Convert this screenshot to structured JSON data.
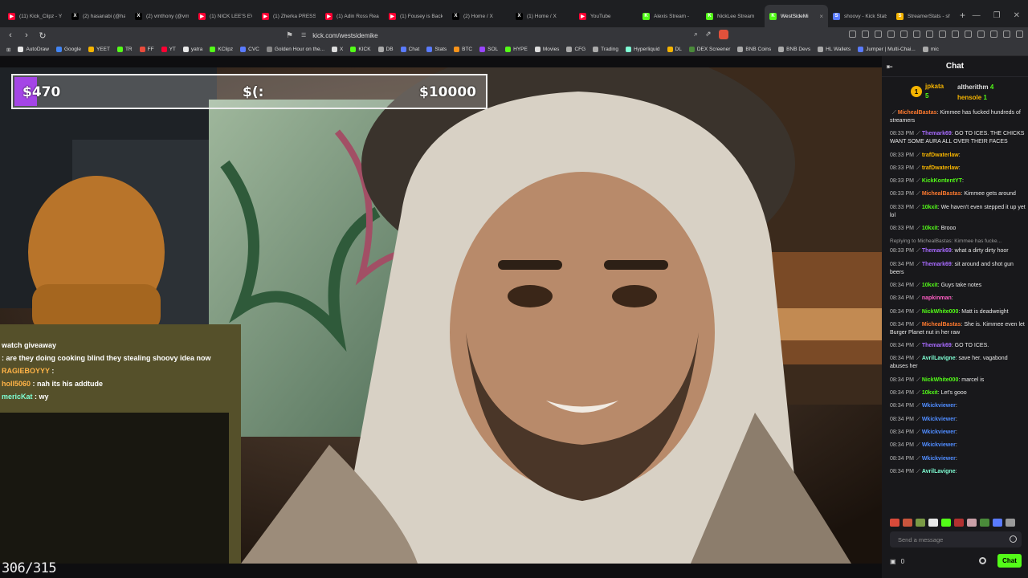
{
  "browser": {
    "tabs": [
      {
        "label": "(11) Kick_Clipz - You",
        "color": "#ff0033",
        "glyph": "▶"
      },
      {
        "label": "(2) hasanabi (@has",
        "color": "#000000",
        "glyph": "X"
      },
      {
        "label": "(2) vmthony (@vmth",
        "color": "#000000",
        "glyph": "X"
      },
      {
        "label": "(1) NICK LEE'S EVEN",
        "color": "#ff0033",
        "glyph": "▶"
      },
      {
        "label": "(1) Zherka PRESSE",
        "color": "#ff0033",
        "glyph": "▶"
      },
      {
        "label": "(1) Adin Ross Reacts",
        "color": "#ff0033",
        "glyph": "▶"
      },
      {
        "label": "(1) Fousey is Back |",
        "color": "#ff0033",
        "glyph": "▶"
      },
      {
        "label": "(2) Home / X",
        "color": "#000000",
        "glyph": "X"
      },
      {
        "label": "(1) Home / X",
        "color": "#000000",
        "glyph": "X"
      },
      {
        "label": "YouTube",
        "color": "#ff0033",
        "glyph": "▶"
      },
      {
        "label": "Alexis Stream -",
        "color": "#53fc18",
        "glyph": "K"
      },
      {
        "label": "NickLee Stream",
        "color": "#53fc18",
        "glyph": "K"
      },
      {
        "label": "WestSideMi",
        "color": "#53fc18",
        "glyph": "K",
        "active": true
      },
      {
        "label": "shoovy - Kick Stats",
        "color": "#5a7bff",
        "glyph": "S"
      },
      {
        "label": "StreamerStats - sho",
        "color": "#f5b400",
        "glyph": "S"
      }
    ],
    "url": "kick.com/westsidemike",
    "bookmarks": [
      "AutoDraw",
      "Google",
      "YEET",
      "TR",
      "FF",
      "YT",
      "yatra",
      "KClipz",
      "CVC",
      "Golden Hour on the...",
      "X",
      "KICK",
      "DB",
      "Chat",
      "Stats",
      "BTC",
      "SOL",
      "HYPE",
      "Movies",
      "CFG",
      "Trading",
      "Hyperliquid",
      "DL",
      "DEX Screener",
      "BNB Coins",
      "BNB Devs",
      "HL Wallets",
      "Jumper | Multi-Chai...",
      "mic"
    ]
  },
  "stream": {
    "overlay": {
      "current": "$470",
      "middle": "$(:",
      "goal": "$10000",
      "progress": 0.047,
      "fill_color": "#a445e6"
    },
    "video_chat": [
      {
        "user": "",
        "text": "watch giveaway",
        "color": "#ffffff"
      },
      {
        "user": "",
        "text": ": are they doing cooking blind they stealing shoovy idea now",
        "color": "#ff6f61"
      },
      {
        "user": "RAGIEBOYYY",
        "text": " : ",
        "color": "#ffb347"
      },
      {
        "user": "holl5060",
        "text": " : nah its his addtude",
        "color": "#ffb347"
      },
      {
        "user": "mericKat",
        "text": " : wy",
        "color": "#7fffd4"
      }
    ],
    "counter": "306/315"
  },
  "chat": {
    "title": "Chat",
    "leaderboard": [
      {
        "name": "jpkata",
        "count": "5"
      },
      {
        "name": "altherithm",
        "count": "4"
      },
      {
        "name": "hensole",
        "count": "1"
      }
    ],
    "messages": [
      {
        "time": "",
        "user": "MichealBastas",
        "color": "#ff7a2f",
        "text": ": Kimmee has fucked hundreds of streamers"
      },
      {
        "time": "08:33 PM",
        "user": "Themark69",
        "color": "#a86bff",
        "text": ": GO TO ICES. THE CHICKS WANT SOME AURA ALL OVER THEIR FACES"
      },
      {
        "time": "08:33 PM",
        "user": "trafDwaterlaw",
        "color": "#f5b400",
        "text": ":"
      },
      {
        "time": "08:33 PM",
        "user": "trafDwaterlaw",
        "color": "#f5b400",
        "text": ":"
      },
      {
        "time": "08:33 PM",
        "user": "KickKontentYT",
        "color": "#53fc18",
        "text": ":"
      },
      {
        "time": "08:33 PM",
        "user": "MichealBastas",
        "color": "#ff7a2f",
        "text": ": Kimmee gets around"
      },
      {
        "time": "08:33 PM",
        "user": "10kxit",
        "color": "#53fc18",
        "text": ": We haven't even stepped it up yet lol"
      },
      {
        "time": "08:33 PM",
        "user": "10kxit",
        "color": "#53fc18",
        "text": ": Brooo"
      },
      {
        "time": "08:33 PM",
        "user": "Themark69",
        "color": "#a86bff",
        "text": ": what a dirty dirty hoor",
        "reply": "Replying to MichealBastas: Kimmee has fucke..."
      },
      {
        "time": "08:34 PM",
        "user": "Themark69",
        "color": "#a86bff",
        "text": ": sit around and shot gun beers"
      },
      {
        "time": "08:34 PM",
        "user": "10kxit",
        "color": "#53fc18",
        "text": ": Guys take notes"
      },
      {
        "time": "08:34 PM",
        "user": "napkinman",
        "color": "#ff5ec4",
        "text": ":"
      },
      {
        "time": "08:34 PM",
        "user": "NickWhite000",
        "color": "#53fc18",
        "text": ": Matt is deadweight"
      },
      {
        "time": "08:34 PM",
        "user": "MichealBastas",
        "color": "#ff7a2f",
        "text": ": She is. Kimmee even let Burger Planet nut in her raw"
      },
      {
        "time": "08:34 PM",
        "user": "Themark69",
        "color": "#a86bff",
        "text": ": GO TO ICES."
      },
      {
        "time": "08:34 PM",
        "user": "AvrilLavigne",
        "color": "#7fffd4",
        "text": ": save her. vagabond abuses her"
      },
      {
        "time": "08:34 PM",
        "user": "NickWhite000",
        "color": "#53fc18",
        "text": ": marcel is"
      },
      {
        "time": "08:34 PM",
        "user": "10kxit",
        "color": "#53fc18",
        "text": ": Let's gooo"
      },
      {
        "time": "08:34 PM",
        "user": "Wkickviewer",
        "color": "#4f8cff",
        "text": ":"
      },
      {
        "time": "08:34 PM",
        "user": "Wkickviewer",
        "color": "#4f8cff",
        "text": ":"
      },
      {
        "time": "08:34 PM",
        "user": "Wkickviewer",
        "color": "#4f8cff",
        "text": ":"
      },
      {
        "time": "08:34 PM",
        "user": "Wkickviewer",
        "color": "#4f8cff",
        "text": ":"
      },
      {
        "time": "08:34 PM",
        "user": "Wkickviewer",
        "color": "#4f8cff",
        "text": ":"
      },
      {
        "time": "08:34 PM",
        "user": "AvrilLavigne",
        "color": "#7fffd4",
        "text": ":"
      }
    ],
    "input_placeholder": "Send a message",
    "viewer_count": "0",
    "send_label": "Chat"
  }
}
